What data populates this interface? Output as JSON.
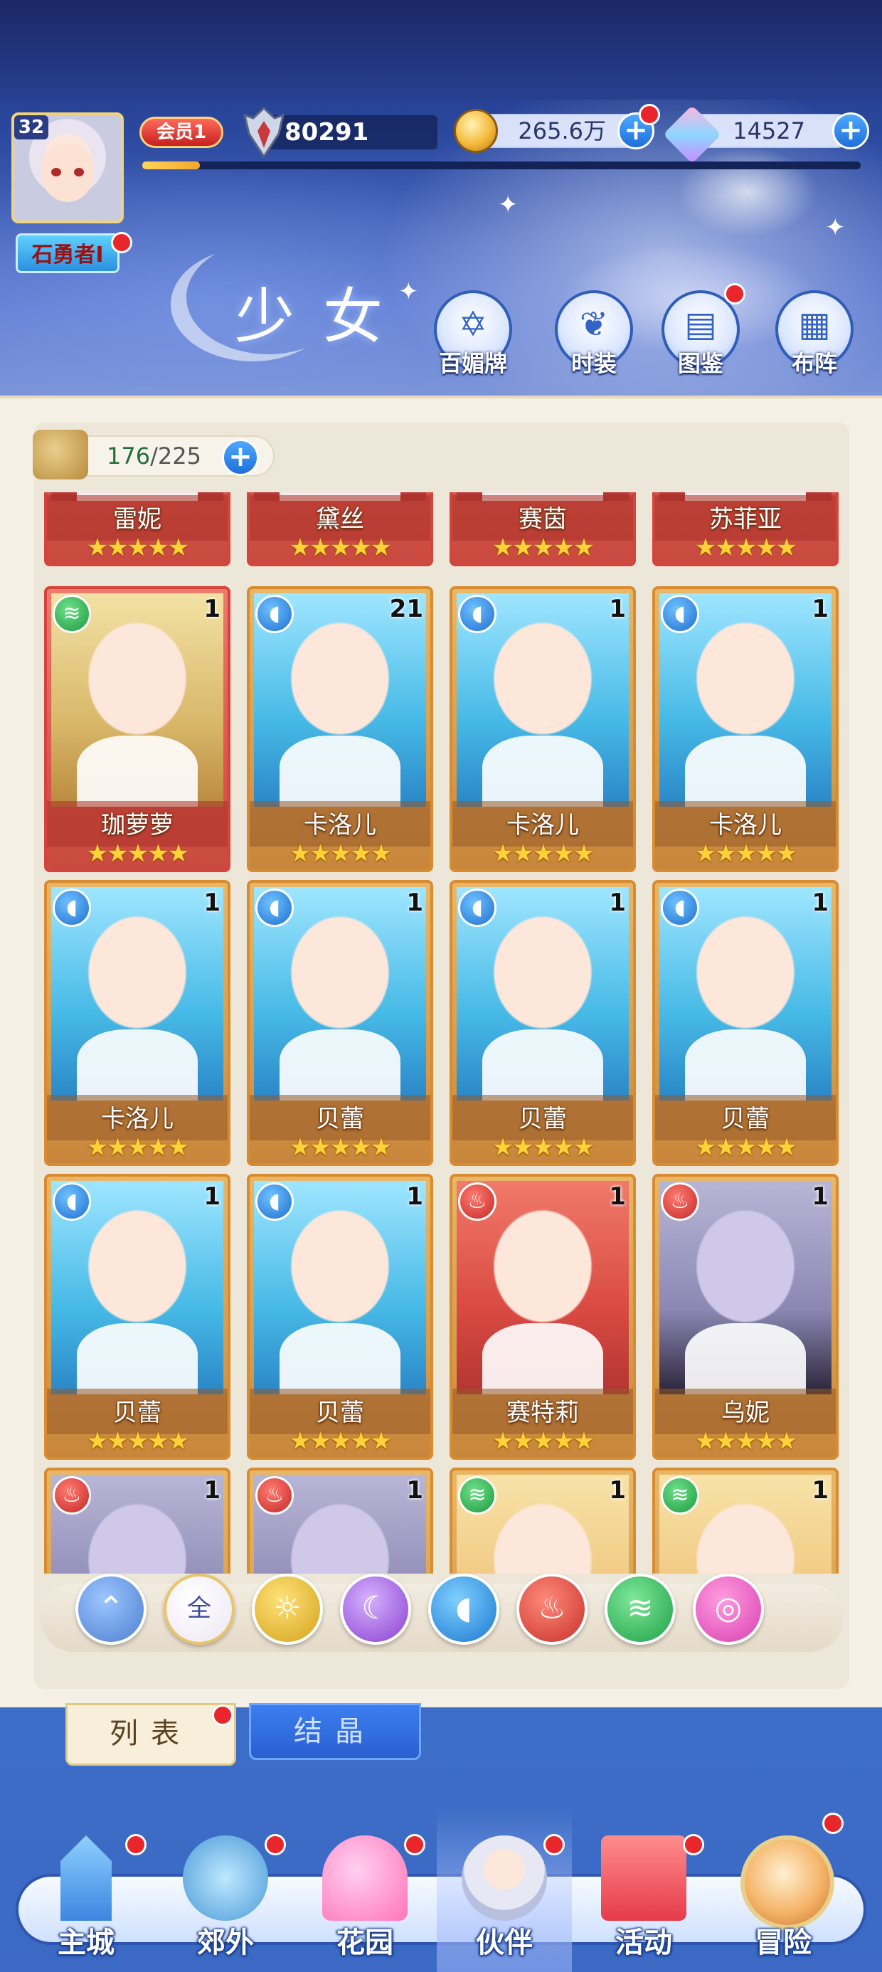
{
  "header": {
    "player_level": "32",
    "username": "石勇者I",
    "vip_label": "会员1",
    "power": "80291",
    "exp_progress": 0.08,
    "coins": "265.6万",
    "gems": "14527",
    "page_title": "少女",
    "nav_buttons": [
      {
        "label": "百媚牌",
        "icon": "card-badge-icon"
      },
      {
        "label": "时装",
        "icon": "costume-icon"
      },
      {
        "label": "图鉴",
        "icon": "book-icon"
      },
      {
        "label": "布阵",
        "icon": "formation-grid-icon"
      }
    ]
  },
  "panel": {
    "capacity_current": "176",
    "capacity_separator": "/",
    "capacity_max": "225",
    "cards": [
      {
        "name": "雷妮",
        "stars": "★★★★★",
        "count": "",
        "element": "",
        "theme": "red",
        "hair": "red"
      },
      {
        "name": "黛丝",
        "stars": "★★★★★",
        "count": "",
        "element": "",
        "theme": "red",
        "hair": "red"
      },
      {
        "name": "赛茵",
        "stars": "★★★★★",
        "count": "",
        "element": "",
        "theme": "red",
        "hair": "red"
      },
      {
        "name": "苏菲亚",
        "stars": "★★★★★",
        "count": "",
        "element": "",
        "theme": "red",
        "hair": "red"
      },
      {
        "name": "珈萝萝",
        "stars": "★★★★★",
        "count": "1",
        "element": "wind",
        "theme": "red",
        "hair": "blonde"
      },
      {
        "name": "卡洛儿",
        "stars": "★★★★★",
        "count": "21",
        "element": "water",
        "theme": "gold",
        "hair": "blue"
      },
      {
        "name": "卡洛儿",
        "stars": "★★★★★",
        "count": "1",
        "element": "water",
        "theme": "gold",
        "hair": "blue"
      },
      {
        "name": "卡洛儿",
        "stars": "★★★★★",
        "count": "1",
        "element": "water",
        "theme": "gold",
        "hair": "blue"
      },
      {
        "name": "卡洛儿",
        "stars": "★★★★★",
        "count": "1",
        "element": "water",
        "theme": "gold",
        "hair": "blue"
      },
      {
        "name": "贝蕾",
        "stars": "★★★★★",
        "count": "1",
        "element": "water",
        "theme": "gold",
        "hair": "blue"
      },
      {
        "name": "贝蕾",
        "stars": "★★★★★",
        "count": "1",
        "element": "water",
        "theme": "gold",
        "hair": "blue"
      },
      {
        "name": "贝蕾",
        "stars": "★★★★★",
        "count": "1",
        "element": "water",
        "theme": "gold",
        "hair": "blue"
      },
      {
        "name": "贝蕾",
        "stars": "★★★★★",
        "count": "1",
        "element": "water",
        "theme": "gold",
        "hair": "blue"
      },
      {
        "name": "贝蕾",
        "stars": "★★★★★",
        "count": "1",
        "element": "water",
        "theme": "gold",
        "hair": "blue"
      },
      {
        "name": "赛特莉",
        "stars": "★★★★★",
        "count": "1",
        "element": "fire",
        "theme": "gold",
        "hair": "red"
      },
      {
        "name": "乌妮",
        "stars": "★★★★★",
        "count": "1",
        "element": "fire",
        "theme": "gold",
        "hair": "grey"
      },
      {
        "name": "",
        "stars": "",
        "count": "1",
        "element": "fire",
        "theme": "gold",
        "hair": "grey"
      },
      {
        "name": "",
        "stars": "",
        "count": "1",
        "element": "fire",
        "theme": "gold",
        "hair": "grey"
      },
      {
        "name": "",
        "stars": "",
        "count": "1",
        "element": "wind",
        "theme": "gold",
        "hair": "pink"
      },
      {
        "name": "",
        "stars": "",
        "count": "1",
        "element": "wind",
        "theme": "gold",
        "hair": "pink"
      }
    ],
    "filters": [
      {
        "key": "light",
        "label": "",
        "icon": "light-element-icon"
      },
      {
        "key": "all",
        "label": "全",
        "icon": "all-filter-icon"
      },
      {
        "key": "sun",
        "label": "",
        "icon": "sun-element-icon"
      },
      {
        "key": "moon",
        "label": "",
        "icon": "moon-element-icon"
      },
      {
        "key": "water",
        "label": "",
        "icon": "water-element-icon"
      },
      {
        "key": "fire",
        "label": "",
        "icon": "fire-element-icon"
      },
      {
        "key": "wind",
        "label": "",
        "icon": "wind-element-icon"
      },
      {
        "key": "pink",
        "label": "",
        "icon": "charm-element-icon"
      }
    ]
  },
  "view_tabs": {
    "list_label": "列表",
    "crystal_label": "结晶"
  },
  "bottom_nav": [
    {
      "label": "主城",
      "icon": "castle-icon",
      "art": "castle",
      "active": false
    },
    {
      "label": "郊外",
      "icon": "suburb-icon",
      "art": "suburb",
      "active": false
    },
    {
      "label": "花园",
      "icon": "garden-heart-icon",
      "art": "garden",
      "active": false
    },
    {
      "label": "伙伴",
      "icon": "partner-icon",
      "art": "partner",
      "active": true
    },
    {
      "label": "活动",
      "icon": "gift-icon",
      "art": "activity",
      "active": false
    },
    {
      "label": "冒险",
      "icon": "compass-icon",
      "art": "adventure",
      "active": false
    }
  ],
  "colors": {
    "accent_blue": "#2b86e0",
    "badge_red": "#e8262b",
    "star_gold": "#ffd23a",
    "card_gold": "#d98b2f",
    "card_red": "#d5443c"
  }
}
